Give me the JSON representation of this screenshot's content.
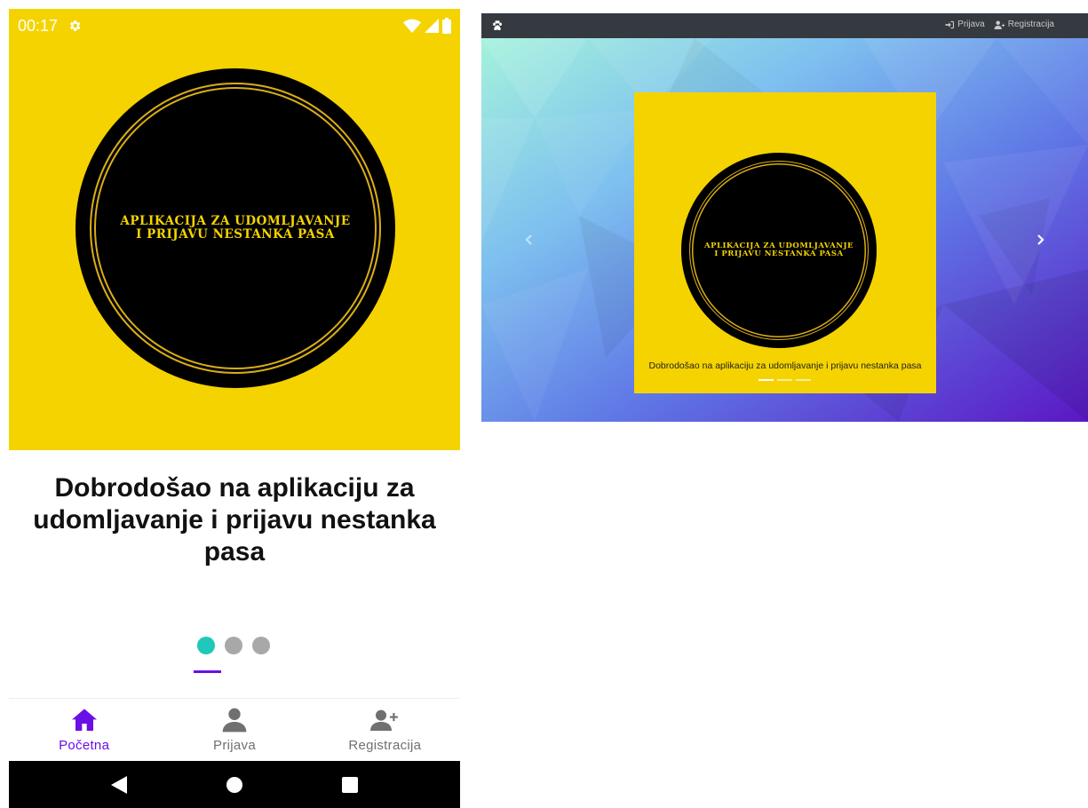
{
  "mobile": {
    "status_bar": {
      "time": "00:17"
    },
    "logo": {
      "line1": "APLIKACIJA ZA UDOMLJAVANJE",
      "line2": "I PRIJAVU NESTANKA PASA"
    },
    "welcome_title": "Dobrodošao na aplikaciju za udomljavanje i prijavu nestanka pasa",
    "pager": {
      "count": 3,
      "active": 0
    },
    "bottom_nav": [
      {
        "label": "Početna",
        "icon": "home-icon",
        "active": true
      },
      {
        "label": "Prijava",
        "icon": "person-icon",
        "active": false
      },
      {
        "label": "Registracija",
        "icon": "person-add-icon",
        "active": false
      }
    ]
  },
  "web": {
    "navbar": {
      "brand_icon": "paw-icon",
      "login_label": "Prijava",
      "register_label": "Registracija"
    },
    "logo": {
      "line1": "APLIKACIJA ZA UDOMLJAVANJE",
      "line2": "I PRIJAVU NESTANKA PASA"
    },
    "caption": "Dobrodošao na aplikaciju za udomljavanje i prijavu nestanka pasa",
    "carousel": {
      "slides": 3,
      "active": 0
    }
  },
  "colors": {
    "logo_yellow": "#f5d300",
    "accent_purple": "#6a0fe6",
    "dot_active": "#1fc8b8",
    "dot_inactive": "#a8a8a8",
    "navbar_dark": "#343a40"
  }
}
